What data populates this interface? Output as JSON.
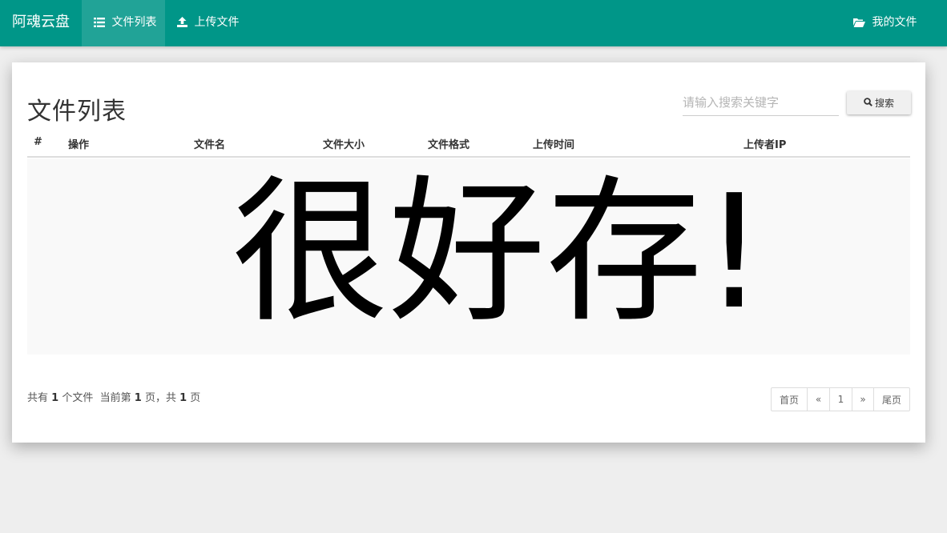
{
  "navbar": {
    "brand": "阿魂云盘",
    "items": [
      {
        "label": "文件列表",
        "icon": "list-icon",
        "active": true
      },
      {
        "label": "上传文件",
        "icon": "upload-icon",
        "active": false
      }
    ],
    "right_item": {
      "label": "我的文件",
      "icon": "folder-open-icon"
    },
    "color": "#009688"
  },
  "main": {
    "title": "文件列表",
    "search": {
      "placeholder": "请输入搜索关键字",
      "value": "",
      "button_label": "搜索"
    },
    "table": {
      "columns": [
        "#",
        "操作",
        "文件名",
        "文件大小",
        "文件格式",
        "上传时间",
        "上传者IP"
      ],
      "big_text": "很好存!"
    },
    "summary": {
      "prefix": "共有",
      "file_count": "1",
      "mid1": "个文件  当前第",
      "current_page": "1",
      "mid2": "页，共",
      "total_pages": "1",
      "suffix": "页"
    },
    "pagination": [
      "首页",
      "«",
      "1",
      "»",
      "尾页"
    ]
  }
}
